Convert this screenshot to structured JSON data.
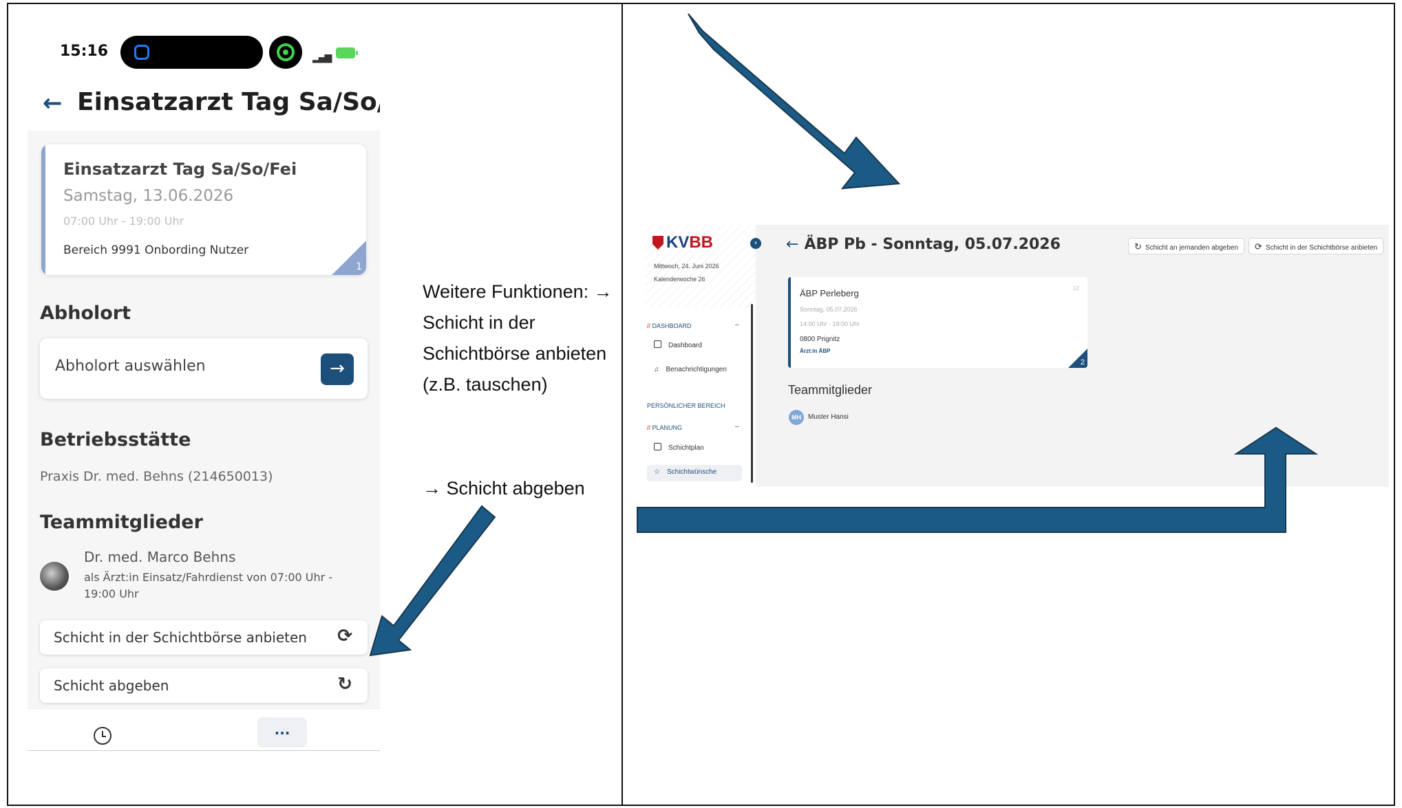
{
  "phone": {
    "status_time": "15:16",
    "title": "Einsatzarzt Tag Sa/So/...",
    "shift": {
      "title": "Einsatzarzt Tag Sa/So/Fei",
      "date": "Samstag, 13.06.2026",
      "time": "07:00 Uhr - 19:00 Uhr",
      "area": "Bereich 9991 Onbording Nutzer",
      "corner_number": "1"
    },
    "pickup_heading": "Abholort",
    "pickup_label": "Abholort auswählen",
    "site_heading": "Betriebsstätte",
    "site_value": "Praxis Dr. med. Behns (214650013)",
    "team_heading": "Teammitglieder",
    "member_name": "Dr. med. Marco Behns",
    "member_role": "als Ärzt:in Einsatz/Fahrdienst von 07:00 Uhr - 19:00 Uhr",
    "btn_exchange": "Schicht in der Schichtbörse anbieten",
    "btn_handover": "Schicht abgeben",
    "more_label": "..."
  },
  "annotation": {
    "text": "Weitere Funktionen: → Schicht in der Schichtbörse anbieten (z.B. tauschen)",
    "text2": "→ Schicht abgeben"
  },
  "web": {
    "logo_k": "KV",
    "logo_bb": "BB",
    "date": "Mittwoch, 24. Juni 2026",
    "week": "Kalenderwoche 26",
    "group_dashboard": "DASHBOARD",
    "item_dashboard": "Dashboard",
    "item_notifications": "Benachrichtigungen",
    "personal": "PERSÖNLICHER BEREICH",
    "group_planning": "PLANUNG",
    "item_schedule": "Schichtplan",
    "item_wishes": "Schichtwünsche",
    "title": "ÄBP Pb - Sonntag, 05.07.2026",
    "btn_handover": "Schicht an jemanden abgeben",
    "btn_exchange": "Schicht in der Schichtbörse anbieten",
    "card": {
      "title": "ÄBP Perleberg",
      "date": "Sonntag, 05.07.2026",
      "time": "14:00 Uhr - 19:00 Uhr",
      "area": "0800 Prignitz",
      "role": "Ärzt:in ÄBP",
      "top_number": "12",
      "corner_number": "2"
    },
    "team_heading": "Teammitglieder",
    "member_initials": "MH",
    "member_name": "Muster Hansi"
  },
  "colors": {
    "arrow": "#1b5a84",
    "brand": "#1c4f7c",
    "red": "#c0161f"
  }
}
